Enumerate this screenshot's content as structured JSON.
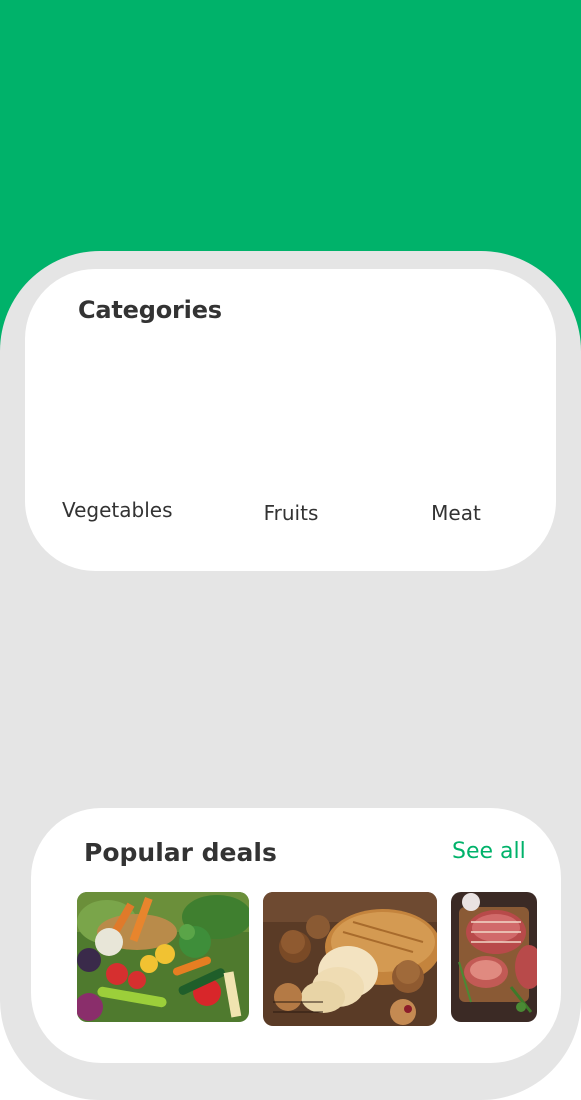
{
  "categories": {
    "title": "Categories",
    "items": [
      {
        "label": "Vegetables"
      },
      {
        "label": "Fruits"
      },
      {
        "label": "Meat"
      }
    ]
  },
  "deals": {
    "title": "Popular deals",
    "see_all_label": "See all",
    "items": [
      {
        "image": "vegetables-basket-image"
      },
      {
        "image": "bread-and-pastries-image"
      },
      {
        "image": "raw-meat-image"
      }
    ]
  },
  "colors": {
    "brand_green": "#00b26a",
    "sheet_gray": "#e5e5e5",
    "card_white": "#ffffff",
    "text_dark": "#333333"
  }
}
